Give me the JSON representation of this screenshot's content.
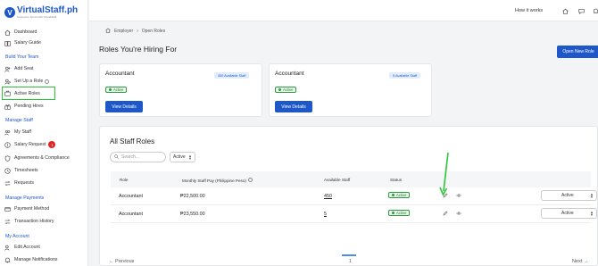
{
  "brand": {
    "name": "VirtualStaff.ph",
    "tagline": "Outsource Smart with VirtualStaff"
  },
  "sidebar": {
    "items": [
      {
        "label": "Dashboard",
        "icon": "home-icon"
      },
      {
        "label": "Salary Guide",
        "icon": "book-icon"
      }
    ],
    "sections": [
      {
        "title": "Build Your Team"
      },
      {
        "title": "Manage Staff"
      },
      {
        "title": "Manage Payments"
      },
      {
        "title": "My Account"
      }
    ],
    "build": [
      {
        "label": "Add Seat"
      },
      {
        "label": "Set Up a Role"
      },
      {
        "label": "Active Roles"
      },
      {
        "label": "Pending Hires"
      }
    ],
    "staff": [
      {
        "label": "My Staff"
      },
      {
        "label": "Salary Request",
        "badge": "1"
      },
      {
        "label": "Agreements & Compliance"
      },
      {
        "label": "Timesheets"
      },
      {
        "label": "Requests"
      }
    ],
    "payments": [
      {
        "label": "Payment Method"
      },
      {
        "label": "Transaction History"
      }
    ],
    "account": [
      {
        "label": "Edit Account"
      },
      {
        "label": "Manage Notifications"
      }
    ]
  },
  "topbar": {
    "how_it_works": "How it works"
  },
  "breadcrumb": {
    "root": "Employer",
    "current": "Open Roles"
  },
  "page": {
    "title": "Roles You're Hiring For",
    "open_role_button": "Open New Role"
  },
  "role_cards": [
    {
      "title": "Accountant",
      "available": "450 Available Staff",
      "status": "Active",
      "button": "View Details"
    },
    {
      "title": "Accountant",
      "available": "5 Available Staff",
      "status": "Active",
      "button": "View Details"
    }
  ],
  "staff_roles": {
    "title": "All Staff Roles",
    "search_placeholder": "Search...",
    "filter_value": "Active",
    "columns": [
      "Role",
      "Monthly Staff Pay (Philippine Peso)",
      "Available Staff",
      "Status"
    ],
    "rows": [
      {
        "role": "Accountant",
        "pay": "₱22,500.00",
        "available": "450",
        "status": "Active",
        "select": "Active"
      },
      {
        "role": "Accountant",
        "pay": "₱23,550.00",
        "available": "5",
        "status": "Active",
        "select": "Active"
      }
    ]
  },
  "pagination": {
    "prev": "Previous",
    "page": "1",
    "next": "Next"
  },
  "colors": {
    "brand": "#1e57c8",
    "highlight": "#2bc33a",
    "active_green": "#2e9b3f",
    "badge_red": "#e02424"
  }
}
